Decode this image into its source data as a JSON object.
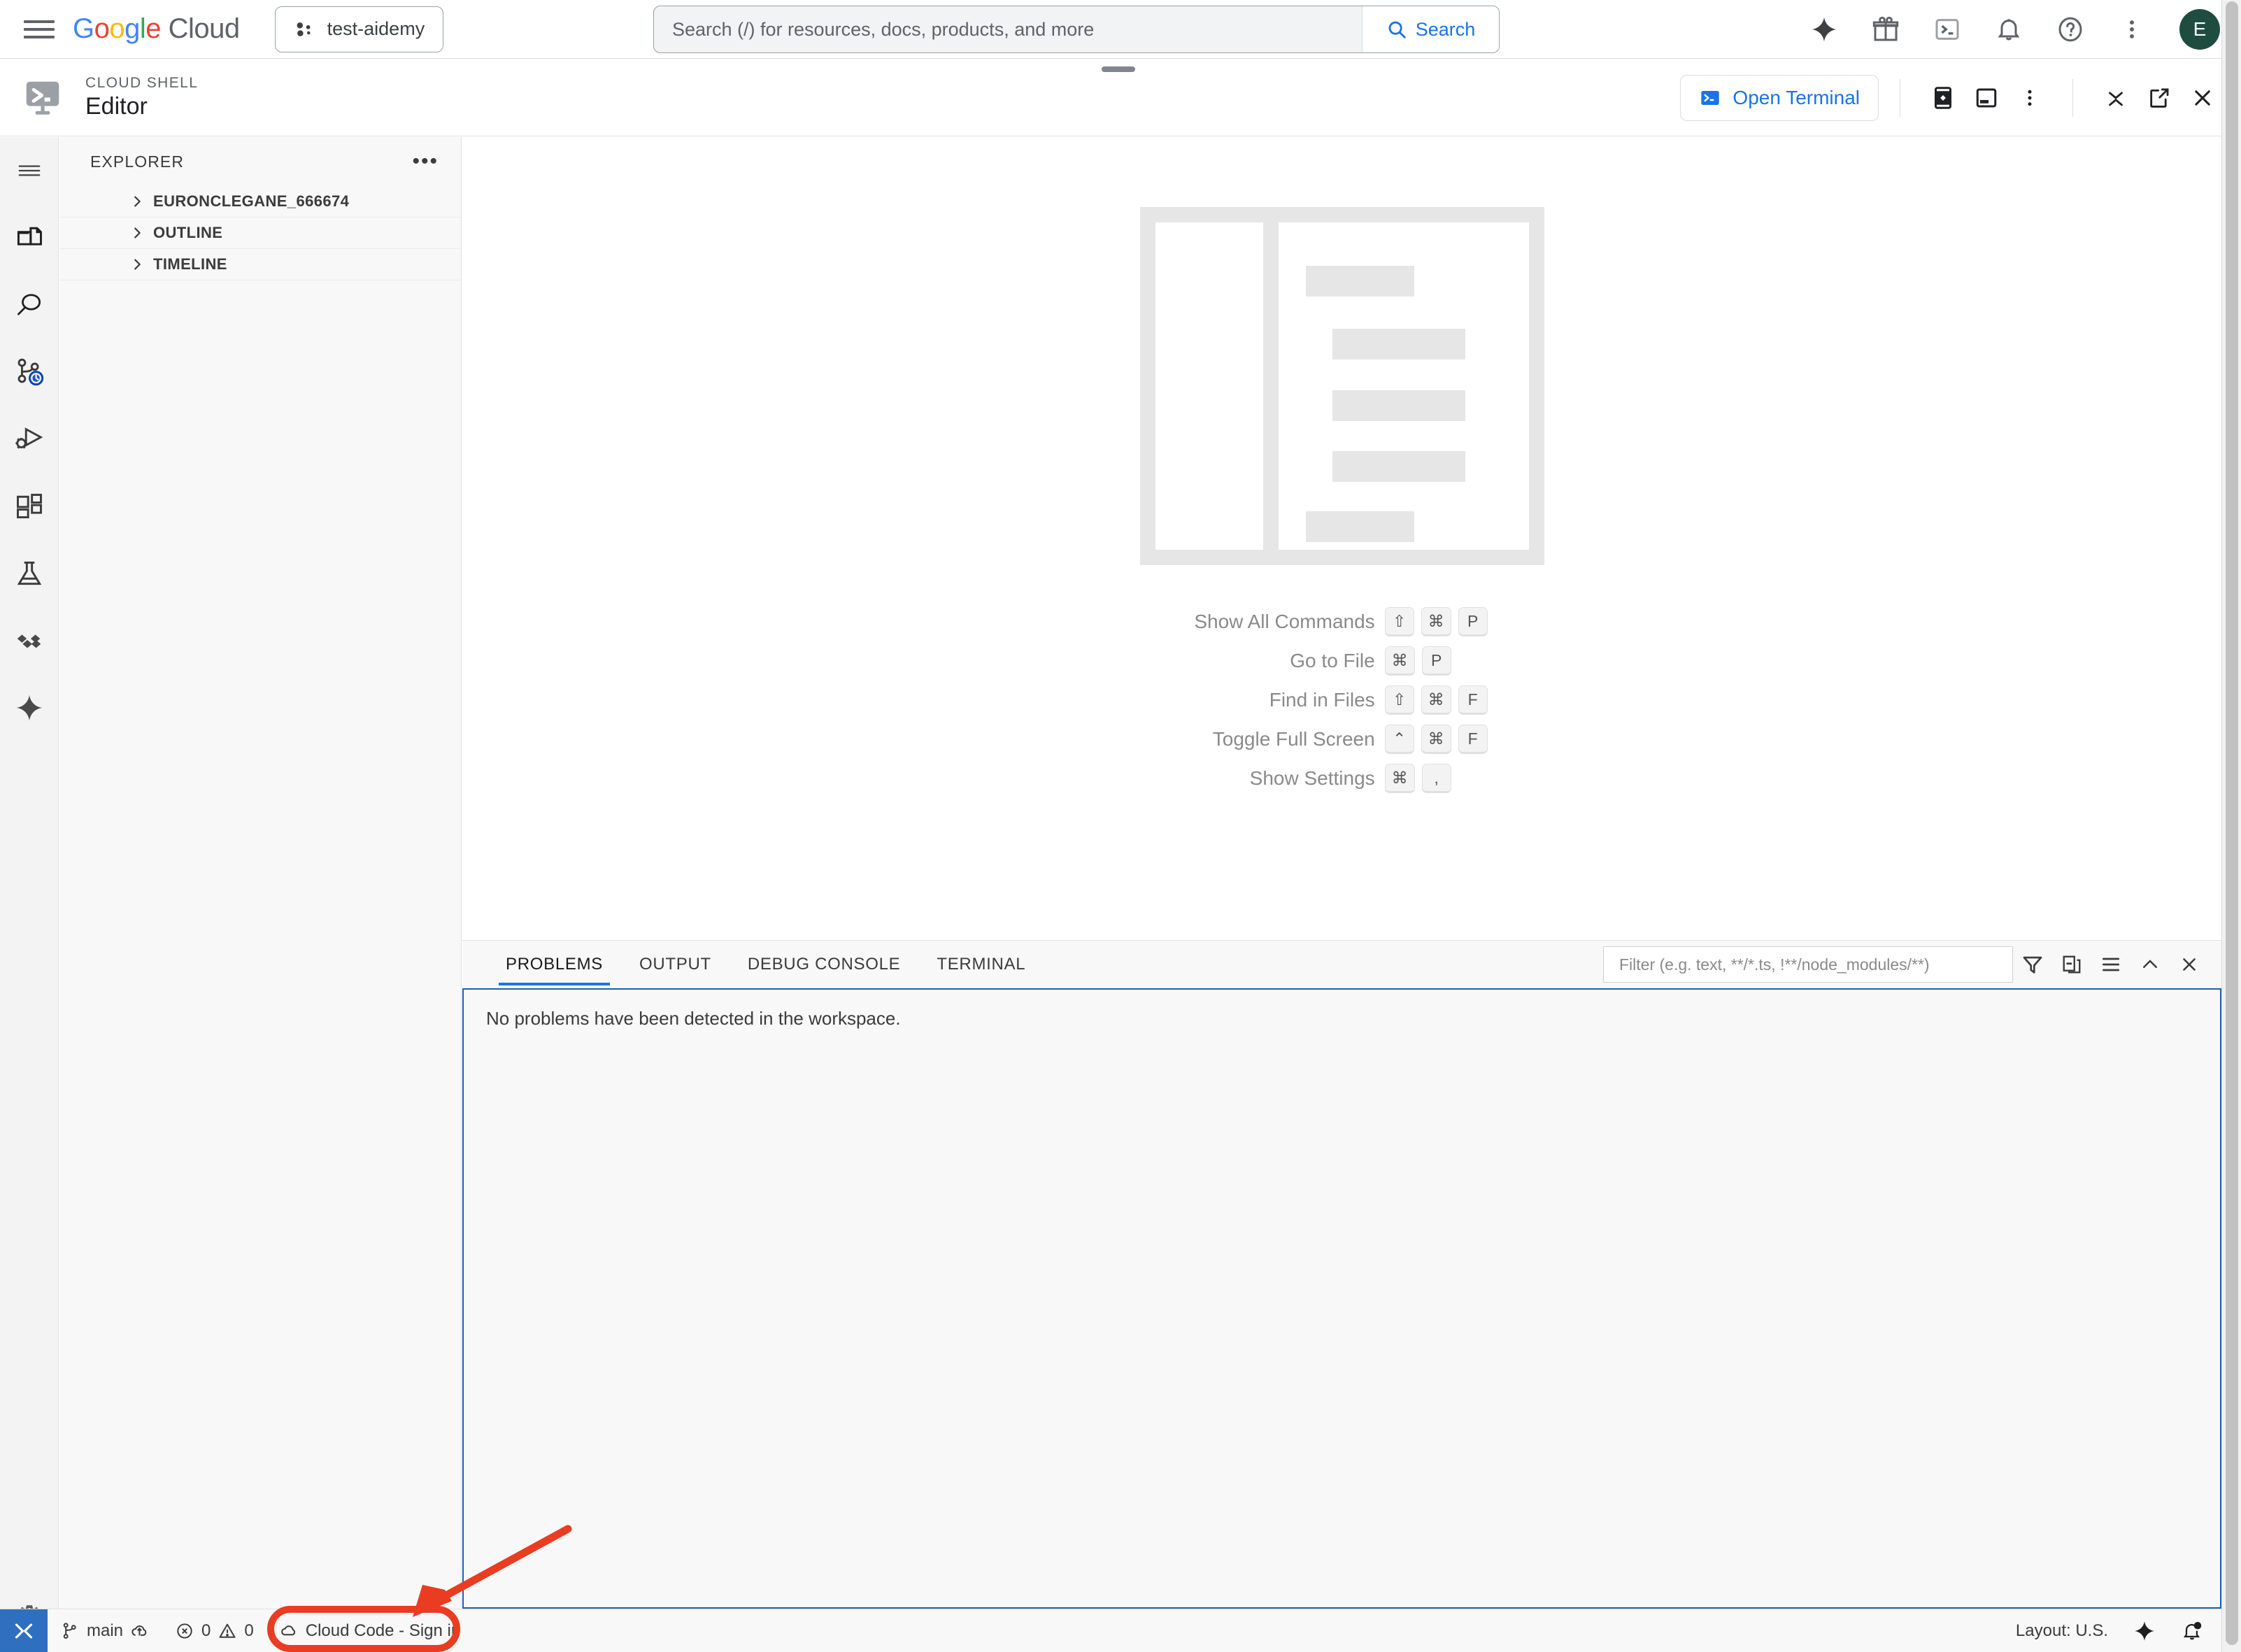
{
  "gcp_header": {
    "menu_icon": "hamburger-icon",
    "logo": {
      "google": "Google",
      "cloud": "Cloud"
    },
    "project_chip": {
      "label": "test-aidemy",
      "icon": "project-dots-icon"
    },
    "search": {
      "placeholder": "Search (/) for resources, docs, products, and more",
      "value": "",
      "button_label": "Search",
      "button_icon": "search-icon"
    },
    "actions": [
      {
        "name": "gemini-sparkle-icon",
        "title": "Gemini"
      },
      {
        "name": "gift-icon",
        "title": "Offers"
      },
      {
        "name": "cloud-shell-icon",
        "title": "Activate Cloud Shell"
      },
      {
        "name": "bell-icon",
        "title": "Notifications"
      },
      {
        "name": "help-icon",
        "title": "Support"
      },
      {
        "name": "more-vert-icon",
        "title": "Settings and utilities"
      }
    ],
    "avatar_initial": "E"
  },
  "cloud_shell": {
    "kicker": "CLOUD SHELL",
    "title": "Editor",
    "logo_icon": "cloud-shell-editor-icon",
    "open_terminal_label": "Open Terminal",
    "open_terminal_icon": "terminal-icon",
    "toolbar_icons": [
      {
        "name": "preview-web-icon",
        "title": "Web Preview"
      },
      {
        "name": "new-terminal-window-icon",
        "title": "New Terminal"
      },
      {
        "name": "more-vert-icon",
        "title": "More"
      },
      {
        "name": "minimize-icon",
        "title": "Minimize"
      },
      {
        "name": "open-new-window-icon",
        "title": "Open in new window"
      },
      {
        "name": "close-icon",
        "title": "Close"
      }
    ]
  },
  "activity_bar": {
    "items": [
      {
        "name": "menu-icon",
        "label": "Menu"
      },
      {
        "name": "explorer-files-icon",
        "label": "Explorer"
      },
      {
        "name": "search-icon",
        "label": "Search"
      },
      {
        "name": "source-control-icon",
        "label": "Source Control"
      },
      {
        "name": "run-debug-icon",
        "label": "Run and Debug"
      },
      {
        "name": "extensions-icon",
        "label": "Extensions"
      },
      {
        "name": "testing-flask-icon",
        "label": "Testing"
      },
      {
        "name": "cloud-code-icon",
        "label": "Cloud Code"
      },
      {
        "name": "gemini-sparkle-icon",
        "label": "Gemini Code Assist"
      }
    ],
    "gear": {
      "name": "gear-icon",
      "label": "Manage"
    }
  },
  "sidebar": {
    "title": "EXPLORER",
    "more_label": "•••",
    "sections": [
      {
        "label": "EURONCLEGANE_666674",
        "expanded": false
      },
      {
        "label": "OUTLINE",
        "expanded": false
      },
      {
        "label": "TIMELINE",
        "expanded": false
      }
    ]
  },
  "welcome": {
    "illustration": "document-placeholder-illustration",
    "shortcuts": [
      {
        "label": "Show All Commands",
        "keys": [
          "⇧",
          "⌘",
          "P"
        ]
      },
      {
        "label": "Go to File",
        "keys": [
          "⌘",
          "P"
        ]
      },
      {
        "label": "Find in Files",
        "keys": [
          "⇧",
          "⌘",
          "F"
        ]
      },
      {
        "label": "Toggle Full Screen",
        "keys": [
          "⌃",
          "⌘",
          "F"
        ]
      },
      {
        "label": "Show Settings",
        "keys": [
          "⌘",
          ","
        ]
      }
    ]
  },
  "panel": {
    "tabs": [
      {
        "label": "PROBLEMS",
        "active": true
      },
      {
        "label": "OUTPUT",
        "active": false
      },
      {
        "label": "DEBUG CONSOLE",
        "active": false
      },
      {
        "label": "TERMINAL",
        "active": false
      }
    ],
    "filter": {
      "placeholder": "Filter (e.g. text, **/*.ts, !**/node_modules/**)",
      "value": ""
    },
    "tool_icons": [
      {
        "name": "filter-funnel-icon",
        "title": "Filter"
      },
      {
        "name": "collapse-all-icon",
        "title": "Collapse All"
      },
      {
        "name": "view-as-list-icon",
        "title": "View as Table"
      },
      {
        "name": "chevron-up-icon",
        "title": "Maximize Panel Size"
      },
      {
        "name": "close-icon",
        "title": "Close Panel"
      }
    ],
    "message": "No problems have been detected in the workspace."
  },
  "status_bar": {
    "remote_icon": "remote-window-icon",
    "left_items": [
      {
        "name": "branch-item",
        "icon": "source-control-branch-icon",
        "label": "main",
        "extra_icon": "cloud-upload-icon"
      },
      {
        "name": "problems-item",
        "icon": "error-circle-icon",
        "label": "0",
        "icon2": "warning-triangle-icon",
        "label2": "0"
      },
      {
        "name": "cloud-code-signin-item",
        "icon": "cloud-code-icon",
        "label": "Cloud Code - Sign in"
      }
    ],
    "right_items": [
      {
        "name": "layout-item",
        "label": "Layout: U.S."
      },
      {
        "name": "gemini-sparkle-icon",
        "label": ""
      },
      {
        "name": "notifications-bell-icon",
        "label": ""
      }
    ]
  },
  "annotations": {
    "highlight_color": "#EA3C21",
    "highlight_target": "Cloud Code - Sign in"
  }
}
